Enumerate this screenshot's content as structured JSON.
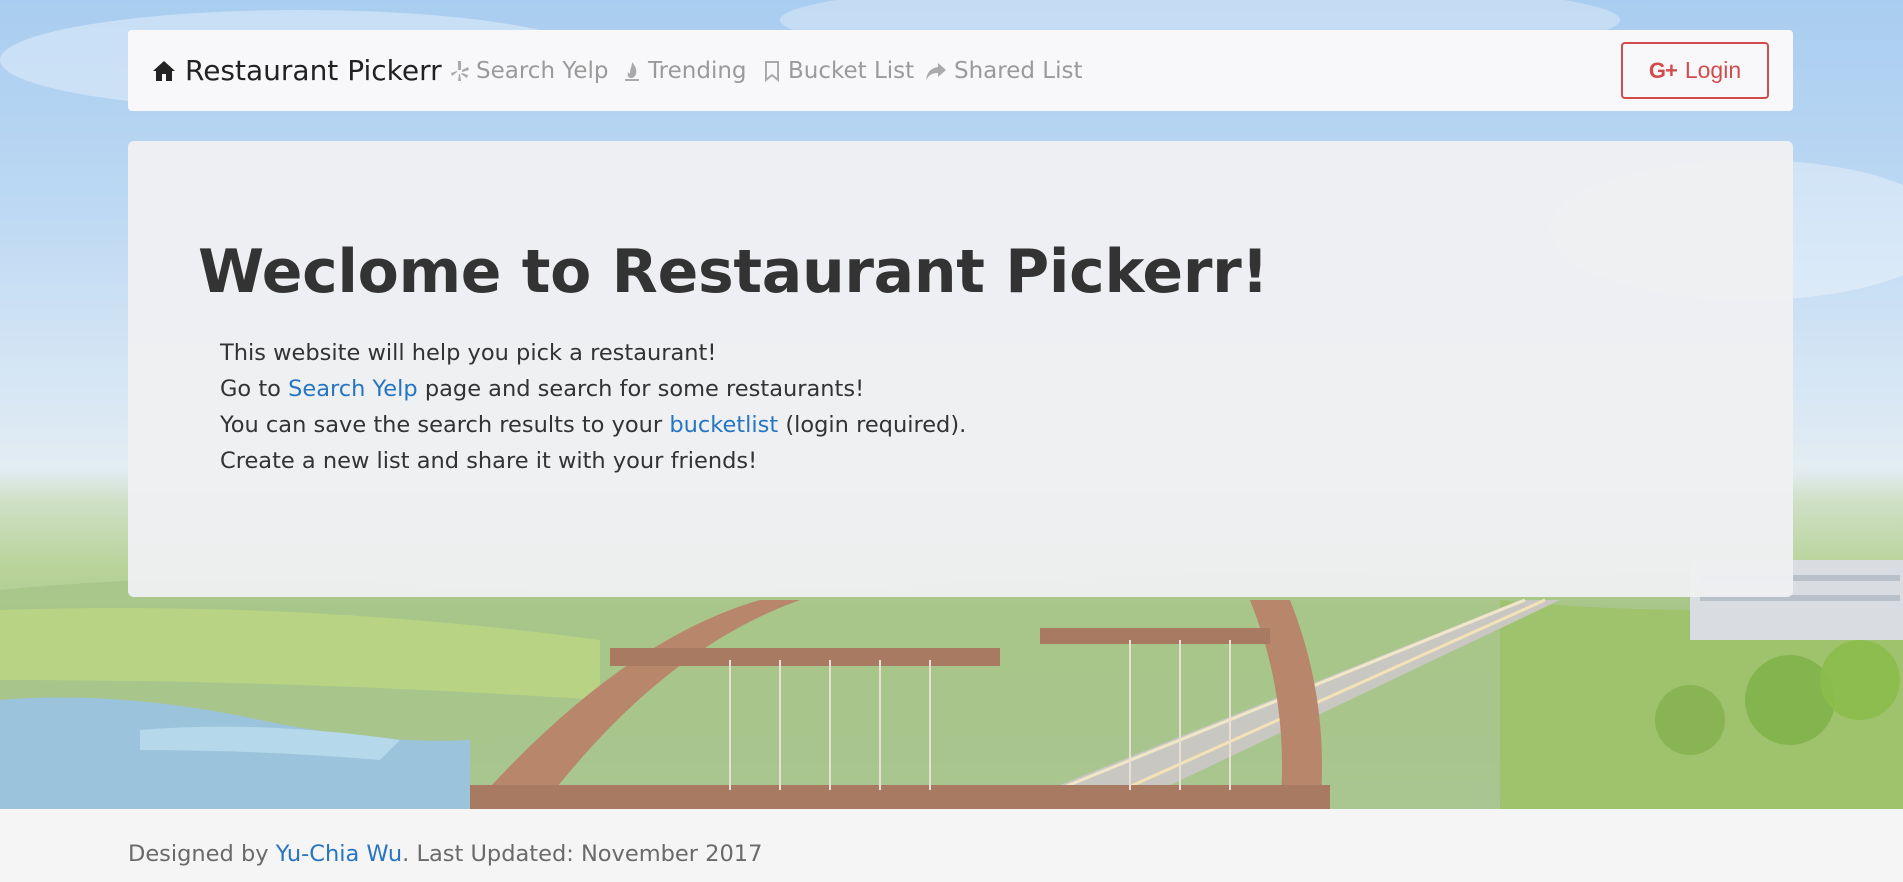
{
  "navbar": {
    "brand": "Restaurant Pickerr",
    "items": [
      {
        "label": "Search Yelp",
        "icon": "yelp-icon"
      },
      {
        "label": "Trending",
        "icon": "fire-icon"
      },
      {
        "label": "Bucket List",
        "icon": "bookmark-icon"
      },
      {
        "label": "Shared List",
        "icon": "share-icon"
      }
    ],
    "login": {
      "label": "Login",
      "icon_text": "G+"
    }
  },
  "jumbotron": {
    "title": "Weclome to Restaurant Pickerr!",
    "line1": "This website will help you pick a restaurant!",
    "line2_pre": "Go to ",
    "line2_link": "Search Yelp",
    "line2_post": " page and search for some restaurants!",
    "line3_pre": "You can save the search results to your ",
    "line3_link": "bucketlist",
    "line3_post": " (login required).",
    "line4": "Create a new list and share it with your friends!"
  },
  "footer": {
    "pre": "Designed by ",
    "author": "Yu-Chia Wu",
    "post": ". Last Updated: November 2017"
  },
  "colors": {
    "link": "#2775c2",
    "login": "#d14d4d",
    "nav_muted": "#9a9a9a"
  }
}
